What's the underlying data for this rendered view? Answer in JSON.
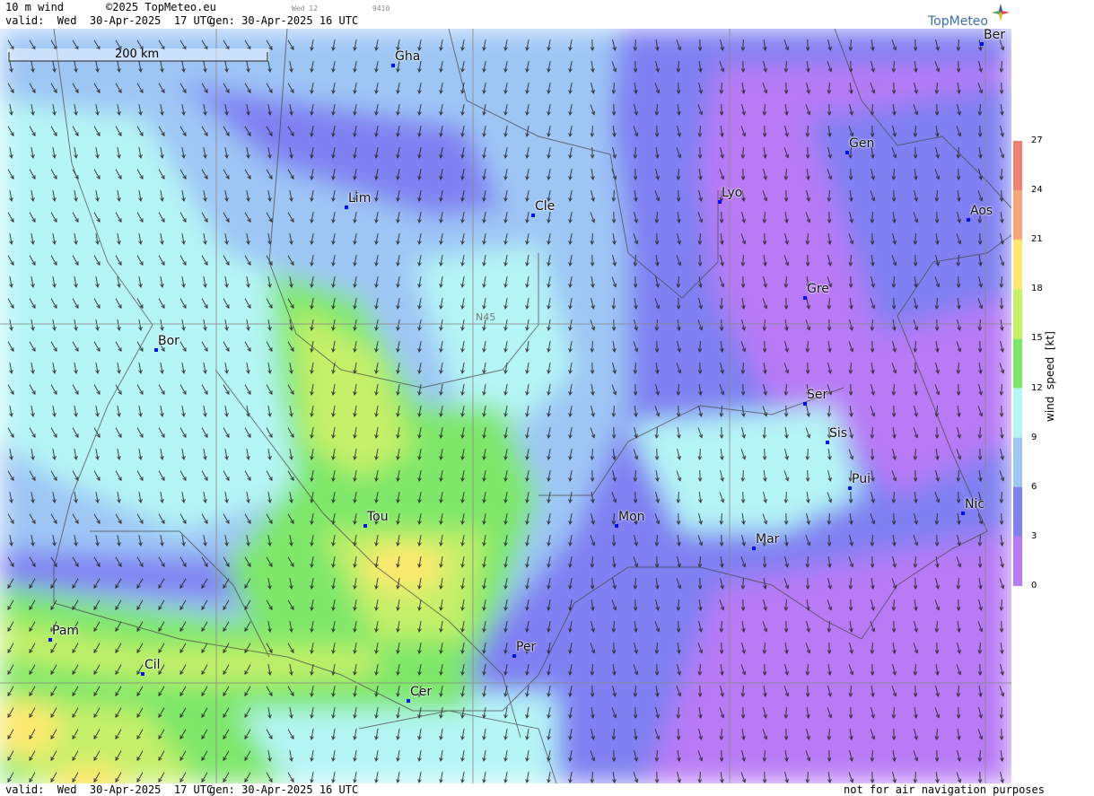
{
  "header": {
    "product": "10 m wind",
    "copyright": "©2025 TopMeteo.eu",
    "day_code": "Wed 12",
    "code_small": "9410",
    "valid": "valid:  Wed  30-Apr-2025  17 UTC",
    "gen": "gen: 30-Apr-2025 16 UTC"
  },
  "logo": {
    "text": "TopMeteo",
    "icon": "compass-star-icon"
  },
  "scale_bar": {
    "label": "200 km"
  },
  "gridline_label": "N45",
  "cities": [
    {
      "name": "Ber"
    },
    {
      "name": "Gha"
    },
    {
      "name": "Gen"
    },
    {
      "name": "Lim"
    },
    {
      "name": "Cle"
    },
    {
      "name": "Lyo"
    },
    {
      "name": "Aos"
    },
    {
      "name": "Gre"
    },
    {
      "name": "Bor"
    },
    {
      "name": "Ser"
    },
    {
      "name": "Sis"
    },
    {
      "name": "Pui"
    },
    {
      "name": "Tou"
    },
    {
      "name": "Mon"
    },
    {
      "name": "Nic"
    },
    {
      "name": "Mar"
    },
    {
      "name": "Pam"
    },
    {
      "name": "Per"
    },
    {
      "name": "Cil"
    },
    {
      "name": "Cer"
    }
  ],
  "legend": {
    "title": "wind  speed  [kt]",
    "ticks": [
      "27",
      "24",
      "21",
      "18",
      "15",
      "12",
      "9",
      "6",
      "3",
      "0"
    ],
    "colors": [
      "#f08070",
      "#f7a77a",
      "#ffe870",
      "#c6f06a",
      "#7ee76a",
      "#b6f5f5",
      "#9ec6f5",
      "#8080f2",
      "#b87af5"
    ]
  },
  "footer": {
    "valid": "valid:  Wed  30-Apr-2025  17 UTC",
    "gen": "gen: 30-Apr-2025 16 UTC",
    "disclaimer": "not for air navigation purposes"
  }
}
